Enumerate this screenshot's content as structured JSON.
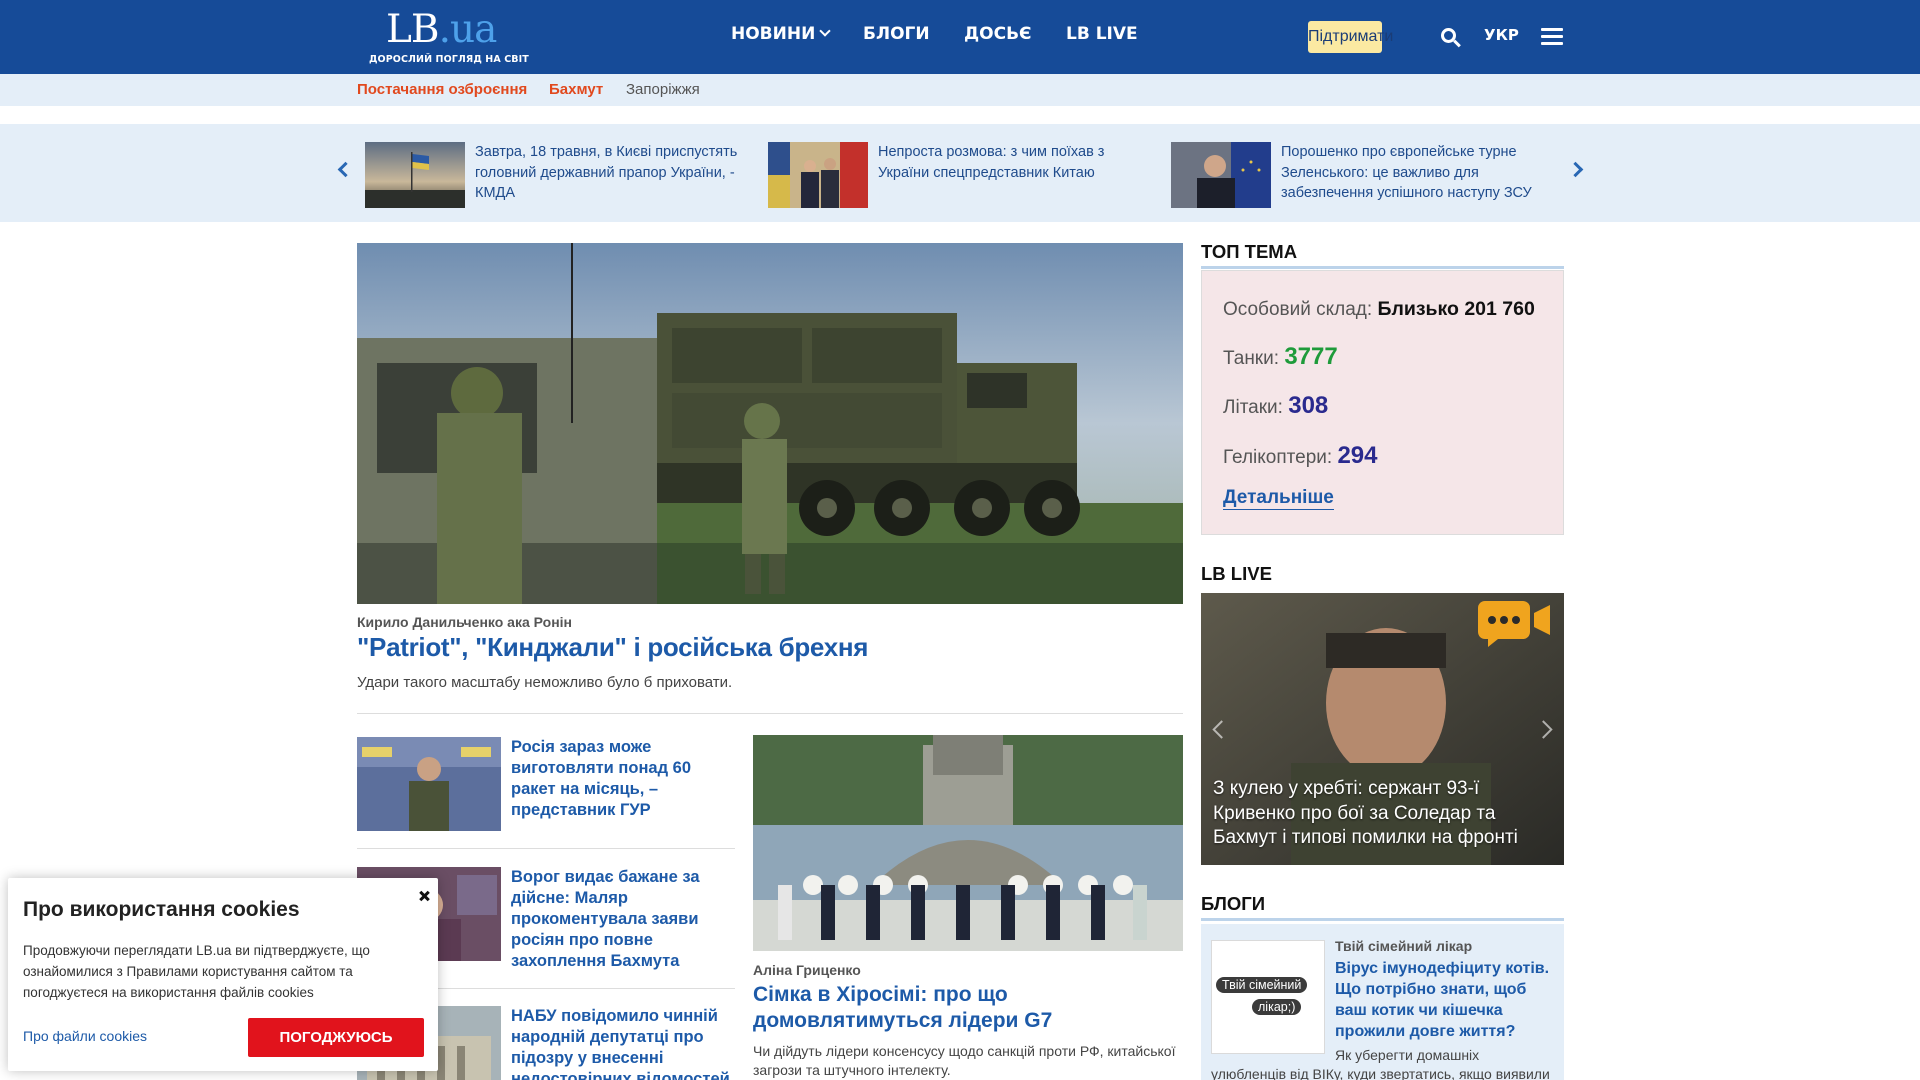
{
  "header": {
    "logo": {
      "mark": "LB",
      "ua": ".ua",
      "tagline": "ДОРОСЛИЙ ПОГЛЯД НА СВІТ"
    },
    "nav": [
      {
        "label": "НОВИНИ"
      },
      {
        "label": "БЛОГИ"
      },
      {
        "label": "ДОСЬЄ"
      },
      {
        "label": "LB LIVE"
      }
    ],
    "support_label": "Підтримати",
    "language": "УКР"
  },
  "tags": [
    {
      "label": "Постачання озброєння"
    },
    {
      "label": "Бахмут"
    },
    {
      "label": "Запоріжжя"
    }
  ],
  "ticker": [
    {
      "title": "Завтра, 18 травня, в Києві приспустять головний державний прапор України, - КМДА"
    },
    {
      "title": "Непроста розмова: з чим поїхав з України спецпредставник Китаю"
    },
    {
      "title": "Порошенко про європейське турне Зеленського: це важливо для забезпечення успішного наступу ЗСУ"
    }
  ],
  "hero": {
    "author": "Кирило Данильченко ака Ронін",
    "title": "\"Patriot\", \"Кинджали\" і російська брехня",
    "lead": "Удари такого масштабу неможливо було б приховати."
  },
  "list": [
    {
      "title": "Росія зараз може виготовляти понад 60 ракет на місяць, – представник ГУР"
    },
    {
      "title": "Ворог видає бажане за дійсне: Маляр прокоментувала заяви росіян про повне захоплення Бахмута"
    },
    {
      "title": "НАБУ повідомило чинній народній депутатці про підозру у внесенні недостовірних відомостей"
    }
  ],
  "g7": {
    "author": "Аліна Гриценко",
    "title": "Сімка в Хіросімі: про що домовлятимуться лідери G7",
    "lead": "Чи дійдуть лідери консенсусу щодо санкцій проти РФ, китайської загрози та штучного інтелекту."
  },
  "top_topic": {
    "heading": "ТОП ТЕМА",
    "personnel_label": "Особовий склад:",
    "personnel_value": "Близько 201 760",
    "tanks_label": "Танки:",
    "tanks_value": "3777",
    "planes_label": "Літаки:",
    "planes_value": "308",
    "helicopters_label": "Гелікоптери:",
    "helicopters_value": "294",
    "more_label": "Детальніше"
  },
  "lb_live": {
    "heading": "LB LIVE",
    "caption": "З кулею у хребті: сержант 93-ї Кривенко про бої за Соледар та Бахмут і типові помилки на фронті"
  },
  "blogs": {
    "heading": "БЛОГИ",
    "thumb_line1": "Твій сімейний",
    "thumb_line2": "лікар;)",
    "author": "Твій сімейний лікар",
    "title": "Вірус імунодефіциту котів. Що потрібно знати, щоб ваш котик чи кішечка прожили довге життя?",
    "lead_line1": "Як уберегти домашніх",
    "lead_line2": "улюбленців від ВІКу, куди звертатись, якщо виявили"
  },
  "cookie": {
    "title": "Про використання cookies",
    "text_line1": "Продовжуючи переглядати LB.ua ви підтверджуєте, що",
    "text_line2": "ознайомилися з Правилами користування сайтом та",
    "text_line3": "погоджуєтеся на використання файлів cookies",
    "link": "Про файли cookies",
    "accept": "ПОГОДЖУЮСЬ"
  },
  "colors": {
    "header_bg": "#164b98",
    "link_blue": "#1d5aa8",
    "hot_tag": "#e1491e",
    "accept_red": "#e1131c",
    "tanks_green": "#1e9b3a",
    "stat_navy": "#2a2a8e"
  }
}
